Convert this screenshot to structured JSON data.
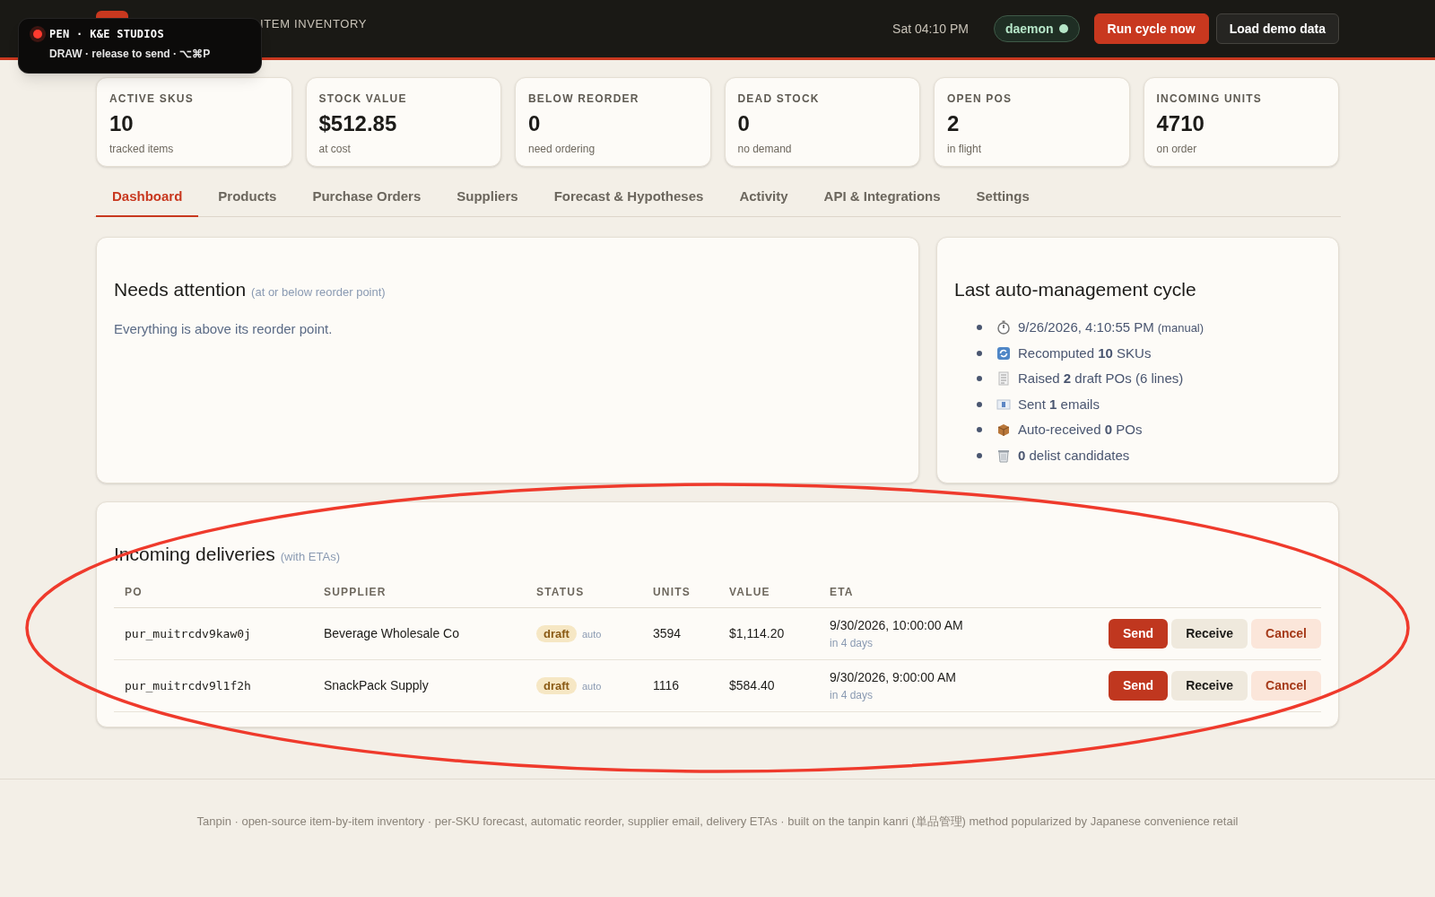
{
  "header": {
    "subtitle": "ITEM INVENTORY",
    "clock": "Sat 04:10 PM",
    "daemon": {
      "label": "daemon",
      "on": true
    },
    "buttons": [
      {
        "label": "Run cycle now",
        "kind": "primary"
      },
      {
        "label": "Load demo data",
        "kind": "secondary"
      }
    ]
  },
  "pen_overlay": {
    "title": "PEN · K&E STUDIOS",
    "hint": "DRAW · release to send · ⌥⌘P",
    "recording": true
  },
  "stats": [
    {
      "label": "ACTIVE SKUS",
      "value": "10",
      "note": "tracked items"
    },
    {
      "label": "STOCK VALUE",
      "value": "$512.85",
      "note": "at cost"
    },
    {
      "label": "BELOW REORDER",
      "value": "0",
      "note": "need ordering"
    },
    {
      "label": "DEAD STOCK",
      "value": "0",
      "note": "no demand"
    },
    {
      "label": "OPEN POS",
      "value": "2",
      "note": "in flight"
    },
    {
      "label": "INCOMING UNITS",
      "value": "4710",
      "note": "on order"
    }
  ],
  "tabs": [
    {
      "label": "Dashboard",
      "selected": true
    },
    {
      "label": "Products",
      "selected": false
    },
    {
      "label": "Purchase Orders",
      "selected": false
    },
    {
      "label": "Suppliers",
      "selected": false
    },
    {
      "label": "Forecast & Hypotheses",
      "selected": false
    },
    {
      "label": "Activity",
      "selected": false
    },
    {
      "label": "API & Integrations",
      "selected": false
    },
    {
      "label": "Settings",
      "selected": false
    }
  ],
  "attention": {
    "title": "Needs attention",
    "hint": "(at or below reorder point)",
    "message": "Everything is above its reorder point."
  },
  "last_cycle": {
    "title": "Last auto-management cycle",
    "items": [
      {
        "kind": "timer",
        "text": "9/26/2026, 4:10:55 PM",
        "note": "(manual)"
      },
      {
        "kind": "refresh",
        "text": "Recomputed **10** SKUs"
      },
      {
        "kind": "receipt",
        "text": "Raised **2** draft POs (6 lines)"
      },
      {
        "kind": "mail",
        "text": "Sent **1** emails"
      },
      {
        "kind": "package",
        "text": "Auto-received **0** POs"
      },
      {
        "kind": "trash",
        "text": "**0** delist candidates"
      }
    ]
  },
  "deliveries": {
    "title": "Incoming deliveries",
    "hint": "(with ETAs)",
    "columns": [
      "PO",
      "SUPPLIER",
      "STATUS",
      "UNITS",
      "VALUE",
      "ETA"
    ],
    "rows": [
      {
        "po": "pur_muitrcdv9kaw0j",
        "supplier": "Beverage Wholesale Co",
        "status": "draft",
        "source": "auto",
        "units": "3594",
        "value": "$1,114.20",
        "eta": "9/30/2026, 10:00:00 AM",
        "eta_note": "in 4 days",
        "actions": [
          "Send",
          "Receive",
          "Cancel"
        ]
      },
      {
        "po": "pur_muitrcdv9l1f2h",
        "supplier": "SnackPack Supply",
        "status": "draft",
        "source": "auto",
        "units": "1116",
        "value": "$584.40",
        "eta": "9/30/2026, 9:00:00 AM",
        "eta_note": "in 4 days",
        "actions": [
          "Send",
          "Receive",
          "Cancel"
        ]
      }
    ]
  },
  "footer": "Tanpin · open-source item-by-item inventory · per-SKU forecast, automatic reorder, supplier email, delivery ETAs · built on the tanpin kanri (単品管理) method popularized by Japanese convenience retail"
}
